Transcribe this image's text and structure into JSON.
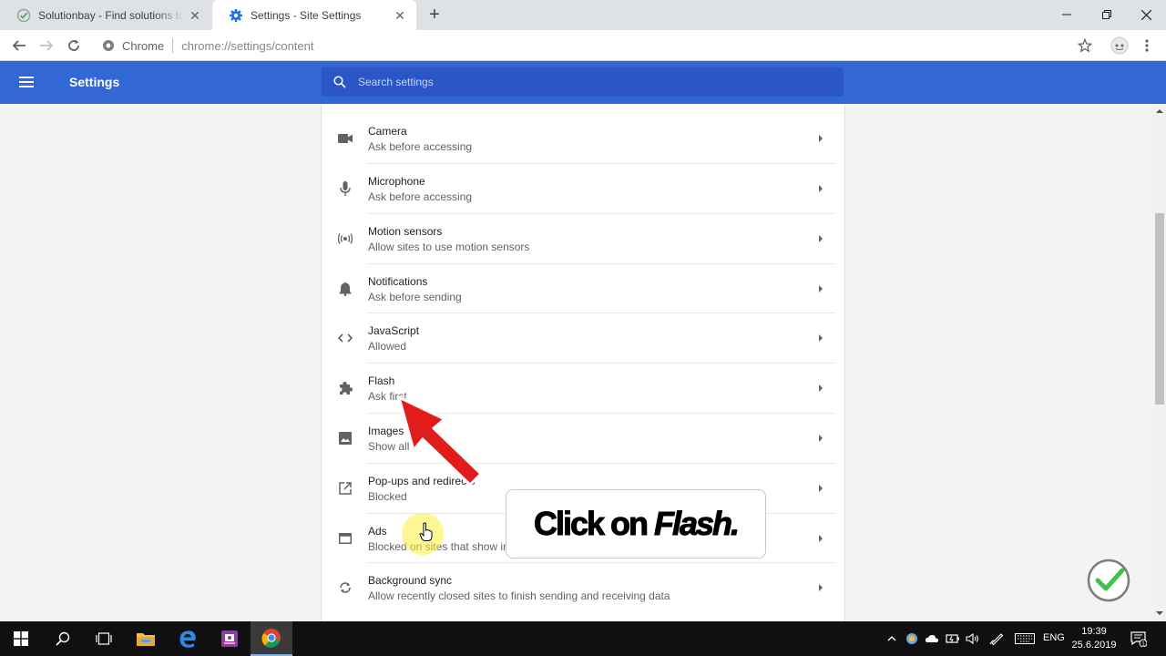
{
  "browser": {
    "tabs": [
      {
        "title": "Solutionbay - Find solutions to your problems",
        "active": false
      },
      {
        "title": "Settings - Site Settings",
        "active": true
      }
    ],
    "omnibox": {
      "scheme": "Chrome",
      "url": "chrome://settings/content"
    }
  },
  "header": {
    "title": "Settings",
    "search_placeholder": "Search settings",
    "color": "#3367d6"
  },
  "site_settings": [
    {
      "label": "Camera",
      "status": "Ask before accessing",
      "icon": "camera-icon"
    },
    {
      "label": "Microphone",
      "status": "Ask before accessing",
      "icon": "microphone-icon"
    },
    {
      "label": "Motion sensors",
      "status": "Allow sites to use motion sensors",
      "icon": "motion-sensors-icon"
    },
    {
      "label": "Notifications",
      "status": "Ask before sending",
      "icon": "bell-icon"
    },
    {
      "label": "JavaScript",
      "status": "Allowed",
      "icon": "code-icon"
    },
    {
      "label": "Flash",
      "status": "Ask first",
      "icon": "puzzle-icon"
    },
    {
      "label": "Images",
      "status": "Show all",
      "icon": "image-icon"
    },
    {
      "label": "Pop-ups and redirects",
      "status": "Blocked",
      "icon": "open-in-new-icon"
    },
    {
      "label": "Ads",
      "status": "Blocked on sites that show intrusive or misleading ads",
      "icon": "ads-icon"
    },
    {
      "label": "Background sync",
      "status": "Allow recently closed sites to finish sending and receiving data",
      "icon": "sync-icon"
    }
  ],
  "annotation": {
    "prefix": "Click on ",
    "emphasis": "Flash."
  },
  "taskbar": {
    "language": "ENG",
    "time": "19:39",
    "date": "25.6.2019",
    "notification_count": "1"
  }
}
